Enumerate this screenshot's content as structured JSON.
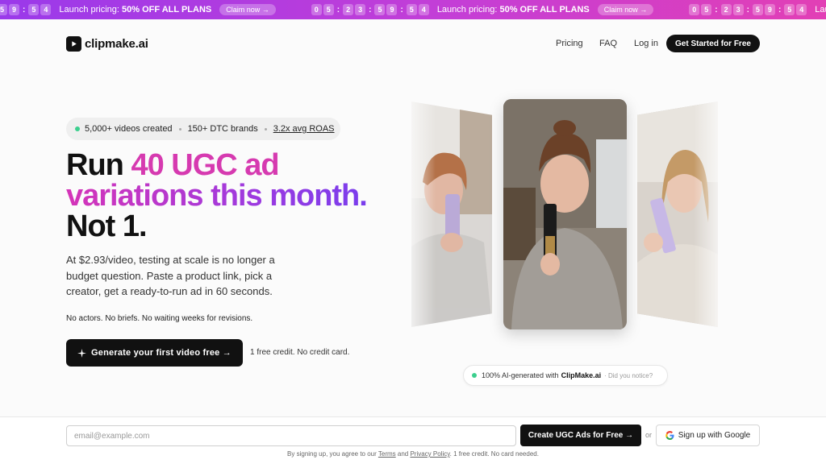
{
  "banner": {
    "timer_digits": [
      "0",
      "5",
      "2",
      "3",
      "5",
      "9",
      "5",
      "4"
    ],
    "lead_digits": [
      "5",
      "9",
      "5",
      "4"
    ],
    "text_prefix": "Launch pricing: ",
    "text_bold": "50% OFF ALL PLANS",
    "claim_label": "Claim now →",
    "colors": {
      "start": "#9a39ea",
      "end": "#e23fb5"
    }
  },
  "header": {
    "logo_text": "clipmake.ai",
    "nav": {
      "pricing": "Pricing",
      "faq": "FAQ",
      "login": "Log in"
    },
    "cta_label": "Get Started for Free"
  },
  "hero": {
    "stats": {
      "videos": "5,000+ videos created",
      "brands": "150+ DTC brands",
      "roas": "3.2x avg ROAS"
    },
    "headline": {
      "run": "Run ",
      "accent_line1": "40 UGC ad",
      "accent_line2": "variations this month.",
      "line3": "Not 1."
    },
    "subcopy": "At $2.93/video, testing at scale is no longer a budget question. Paste a product link, pick a creator, get a ready-to-run ad in 60 seconds.",
    "note": "No actors. No briefs. No waiting weeks for revisions.",
    "cta_label": "Generate your first video free →",
    "credit_note": "1 free credit. No credit card.",
    "accent_color": "#d534b8"
  },
  "showcase": {
    "ai_badge_prefix": "100% AI-generated with",
    "ai_badge_brand": "ClipMake.ai",
    "ai_badge_suffix": "· Did you notice?"
  },
  "signup_bar": {
    "email_placeholder": "email@example.com",
    "create_label": "Create UGC Ads for Free →",
    "or_text": "or",
    "google_label": "Sign up with Google",
    "legal": {
      "prefix": "By signing up, you agree to our ",
      "terms": "Terms",
      "and": " and ",
      "privacy": "Privacy Policy",
      "suffix": ". 1 free credit. No card needed."
    }
  }
}
